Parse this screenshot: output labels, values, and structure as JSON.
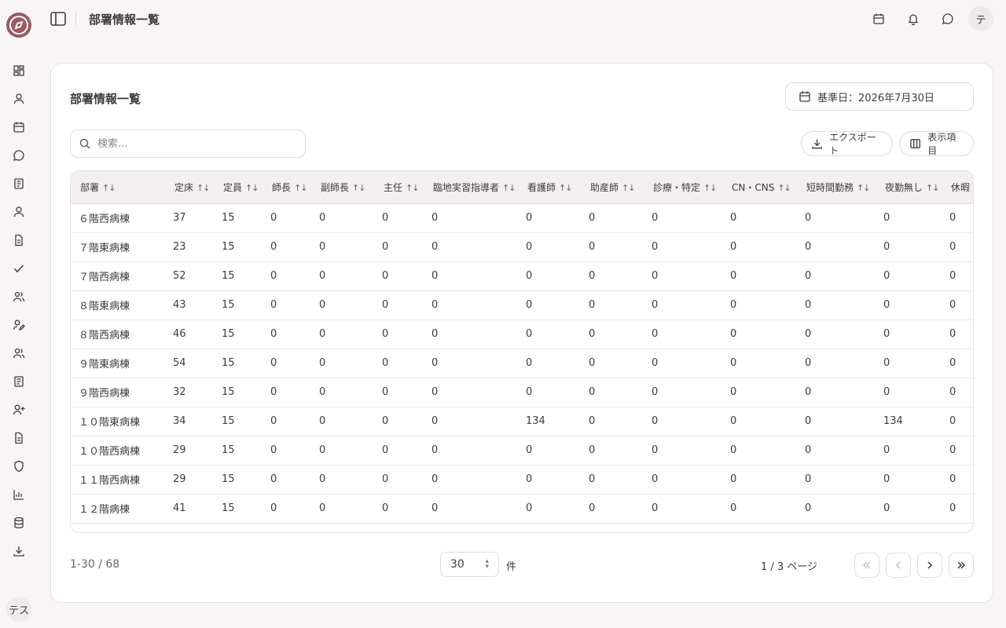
{
  "app": {
    "user_initial_rail": "テス",
    "user_initial_top": "テ"
  },
  "header": {
    "title": "部署情報一覧"
  },
  "card": {
    "title": "部署情報一覧",
    "date_label": "基準日：2026年7月30日",
    "search_placeholder": "検索...",
    "export_label": "エクスポート",
    "columns_label": "表示項目"
  },
  "table": {
    "columns": [
      "部署",
      "定床",
      "定員",
      "師長",
      "副師長",
      "主任",
      "臨地実習指導者",
      "看護師",
      "助産師",
      "診療・特定",
      "CN・CNS",
      "短時間勤務",
      "夜勤無し",
      "休暇"
    ],
    "rows": [
      [
        "６階西病棟",
        "37",
        "15",
        "0",
        "0",
        "0",
        "0",
        "0",
        "0",
        "0",
        "0",
        "0",
        "0",
        "0"
      ],
      [
        "７階東病棟",
        "23",
        "15",
        "0",
        "0",
        "0",
        "0",
        "0",
        "0",
        "0",
        "0",
        "0",
        "0",
        "0"
      ],
      [
        "７階西病棟",
        "52",
        "15",
        "0",
        "0",
        "0",
        "0",
        "0",
        "0",
        "0",
        "0",
        "0",
        "0",
        "0"
      ],
      [
        "８階東病棟",
        "43",
        "15",
        "0",
        "0",
        "0",
        "0",
        "0",
        "0",
        "0",
        "0",
        "0",
        "0",
        "0"
      ],
      [
        "８階西病棟",
        "46",
        "15",
        "0",
        "0",
        "0",
        "0",
        "0",
        "0",
        "0",
        "0",
        "0",
        "0",
        "0"
      ],
      [
        "９階東病棟",
        "54",
        "15",
        "0",
        "0",
        "0",
        "0",
        "0",
        "0",
        "0",
        "0",
        "0",
        "0",
        "0"
      ],
      [
        "９階西病棟",
        "32",
        "15",
        "0",
        "0",
        "0",
        "0",
        "0",
        "0",
        "0",
        "0",
        "0",
        "0",
        "0"
      ],
      [
        "１０階東病棟",
        "34",
        "15",
        "0",
        "0",
        "0",
        "0",
        "134",
        "0",
        "0",
        "0",
        "0",
        "134",
        "0"
      ],
      [
        "１０階西病棟",
        "29",
        "15",
        "0",
        "0",
        "0",
        "0",
        "0",
        "0",
        "0",
        "0",
        "0",
        "0",
        "0"
      ],
      [
        "１１階西病棟",
        "29",
        "15",
        "0",
        "0",
        "0",
        "0",
        "0",
        "0",
        "0",
        "0",
        "0",
        "0",
        "0"
      ],
      [
        "１２階病棟",
        "41",
        "15",
        "0",
        "0",
        "0",
        "0",
        "0",
        "0",
        "0",
        "0",
        "0",
        "0",
        "0"
      ]
    ]
  },
  "pagination": {
    "range": "1-30 / 68",
    "page_size": "30",
    "page_size_unit": "件",
    "page_info": "1 / 3 ページ"
  },
  "colors": {
    "accent": "#9a5a63",
    "background": "#f9f5f6",
    "header_row": "#f3eef0"
  }
}
